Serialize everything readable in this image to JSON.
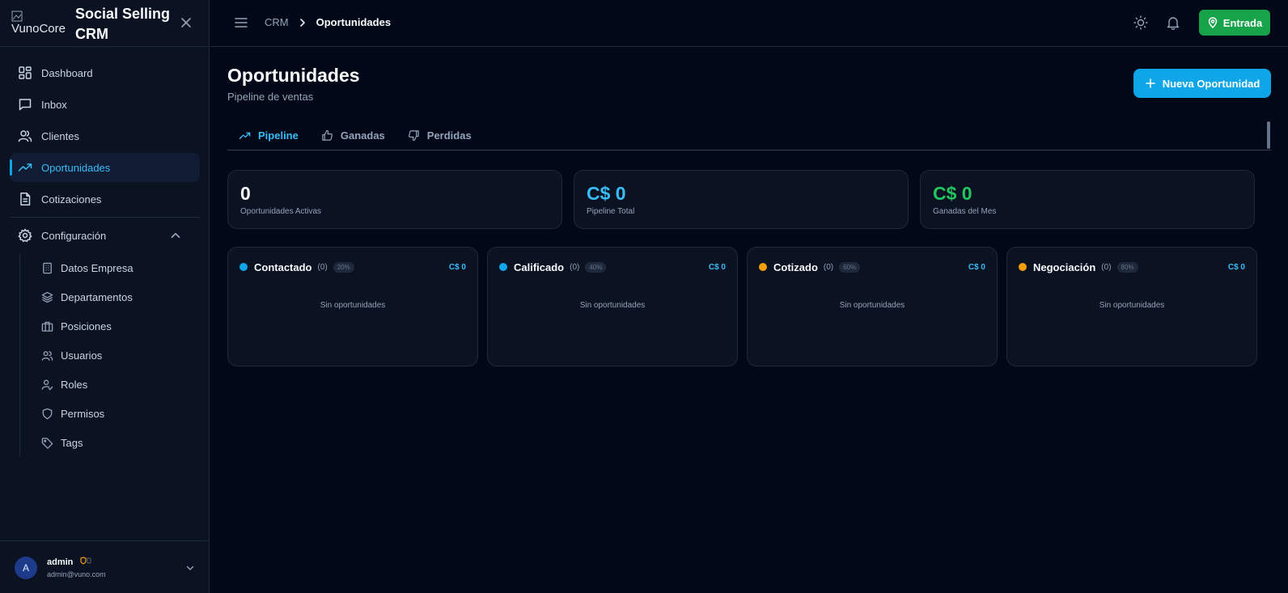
{
  "brand": {
    "logo_alt": "VunoCore",
    "title": "Social Selling CRM"
  },
  "sidebar": {
    "items": [
      {
        "label": "Dashboard",
        "icon": "dashboard-icon"
      },
      {
        "label": "Inbox",
        "icon": "inbox-icon"
      },
      {
        "label": "Clientes",
        "icon": "users-icon"
      },
      {
        "label": "Oportunidades",
        "icon": "trending-up-icon",
        "active": true
      },
      {
        "label": "Cotizaciones",
        "icon": "file-text-icon"
      }
    ],
    "config": {
      "label": "Configuración",
      "icon": "gear-icon"
    },
    "subitems": [
      {
        "label": "Datos Empresa",
        "icon": "building-icon"
      },
      {
        "label": "Departamentos",
        "icon": "layers-icon"
      },
      {
        "label": "Posiciones",
        "icon": "briefcase-icon"
      },
      {
        "label": "Usuarios",
        "icon": "users-icon"
      },
      {
        "label": "Roles",
        "icon": "user-check-icon"
      },
      {
        "label": "Permisos",
        "icon": "shield-icon"
      },
      {
        "label": "Tags",
        "icon": "tag-icon"
      }
    ]
  },
  "user": {
    "initial": "A",
    "name": "admin",
    "email": "admin@vuno.com"
  },
  "topbar": {
    "breadcrumb": [
      "CRM",
      "Oportunidades"
    ],
    "entrada_label": "Entrada"
  },
  "page": {
    "title": "Oportunidades",
    "subtitle": "Pipeline de ventas",
    "new_button_label": "Nueva Oportunidad",
    "tabs": [
      {
        "label": "Pipeline",
        "active": true
      },
      {
        "label": "Ganadas"
      },
      {
        "label": "Perdidas"
      }
    ]
  },
  "stats": [
    {
      "value": "0",
      "label": "Oportunidades Activas",
      "color": "#f8fafc"
    },
    {
      "value": "C$ 0",
      "label": "Pipeline Total",
      "color": "#38bdf8"
    },
    {
      "value": "C$ 0",
      "label": "Ganadas del Mes",
      "color": "#22c55e"
    }
  ],
  "pipeline": [
    {
      "name": "Contactado",
      "count": "(0)",
      "pct": "20%",
      "amount": "C$ 0",
      "dot_color": "#0ea5e9",
      "empty": "Sin oportunidades"
    },
    {
      "name": "Calificado",
      "count": "(0)",
      "pct": "40%",
      "amount": "C$ 0",
      "dot_color": "#0ea5e9",
      "empty": "Sin oportunidades"
    },
    {
      "name": "Cotizado",
      "count": "(0)",
      "pct": "60%",
      "amount": "C$ 0",
      "dot_color": "#f59e0b",
      "empty": "Sin oportunidades"
    },
    {
      "name": "Negociación",
      "count": "(0)",
      "pct": "80%",
      "amount": "C$ 0",
      "dot_color": "#f59e0b",
      "empty": "Sin oportunidades"
    }
  ]
}
